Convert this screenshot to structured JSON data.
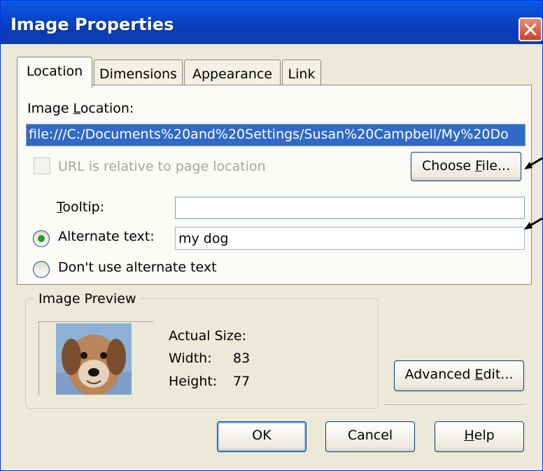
{
  "window": {
    "title": "Image Properties"
  },
  "tabs": [
    {
      "label": "Location"
    },
    {
      "label": "Dimensions"
    },
    {
      "label": "Appearance"
    },
    {
      "label": "Link"
    }
  ],
  "location": {
    "label_pre": "Image ",
    "label_key": "L",
    "label_post": "ocation:",
    "value": "file:///C:/Documents%20and%20Settings/Susan%20Campbell/My%20Do",
    "relative_label": "URL is relative to page location",
    "choose_pre": "Choose ",
    "choose_key": "F",
    "choose_post": "ile..."
  },
  "tooltip": {
    "label_key": "T",
    "label_post": "ooltip:",
    "value": ""
  },
  "alt": {
    "label": "Alternate text:",
    "value": "my dog",
    "selected": true,
    "no_alt_label": "Don't use alternate text"
  },
  "preview": {
    "group_title": "Image Preview",
    "actual_size_label": "Actual Size:",
    "width_label": "Width:",
    "width_value": "83",
    "height_label": "Height:",
    "height_value": "77",
    "image_icon": "dog-photo"
  },
  "buttons": {
    "advanced_pre": "Advanced ",
    "advanced_key": "E",
    "advanced_post": "dit...",
    "ok": "OK",
    "cancel": "Cancel",
    "help_key": "H",
    "help_post": "elp"
  },
  "colors": {
    "title_bar": "#0846c8",
    "selection": "#3169c6",
    "close_button": "#c9452a",
    "radio_dot": "#21a121"
  }
}
